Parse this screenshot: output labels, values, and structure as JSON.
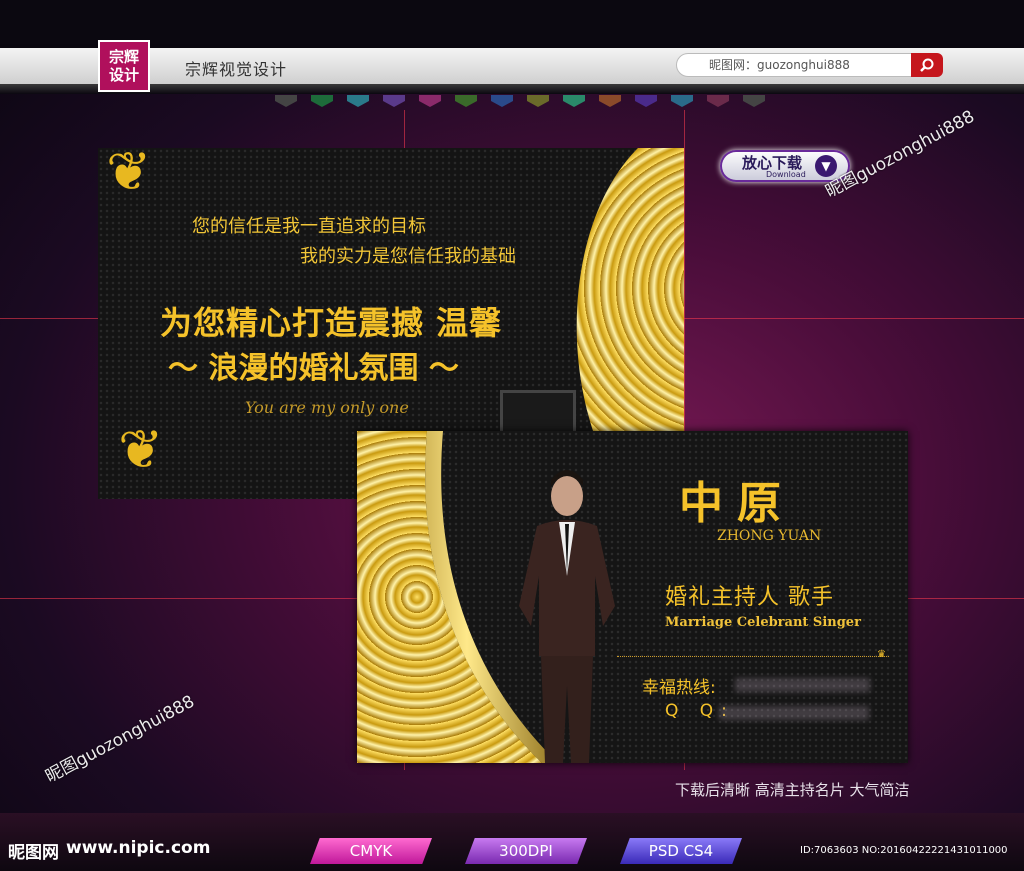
{
  "header": {
    "logo_text": "宗辉设计",
    "brand_title": "宗辉视觉设计",
    "search_text": "昵图网：guozonghui888",
    "search_button_icon": "search-icon"
  },
  "card_front": {
    "line1": "您的信任是我一直追求的目标",
    "line2": "我的实力是您信任我的基础",
    "slogan1": "为您精心打造震撼 温馨",
    "slogan2": "～ 浪漫的婚礼氛围 ～",
    "english": "You are my only one"
  },
  "card_back": {
    "name": "中原",
    "pinyin": "ZHONG YUAN",
    "role": "婚礼主持人 歌手",
    "role_en": "Marriage Celebrant Singer",
    "hotline_label": "幸福热线:",
    "qq_label": "Q Q:"
  },
  "download": {
    "label": "放心下载",
    "sub": "Download",
    "icon": "chevron-down-icon"
  },
  "watermarks": [
    "昵图guozonghui888",
    "昵图guozonghui888"
  ],
  "tags": "下载后清晰   高清主持名片  大气简洁",
  "footer": {
    "site_logo": "昵图网",
    "site_url": "www.nipic.com",
    "badges": [
      "CMYK",
      "300DPI",
      "PSD CS4"
    ],
    "id_text": "ID:7063603 NO:20160422221431011000"
  },
  "colors": {
    "gold": "#f5c22a",
    "brand_magenta": "#b0105c",
    "search_red": "#c5161c"
  }
}
